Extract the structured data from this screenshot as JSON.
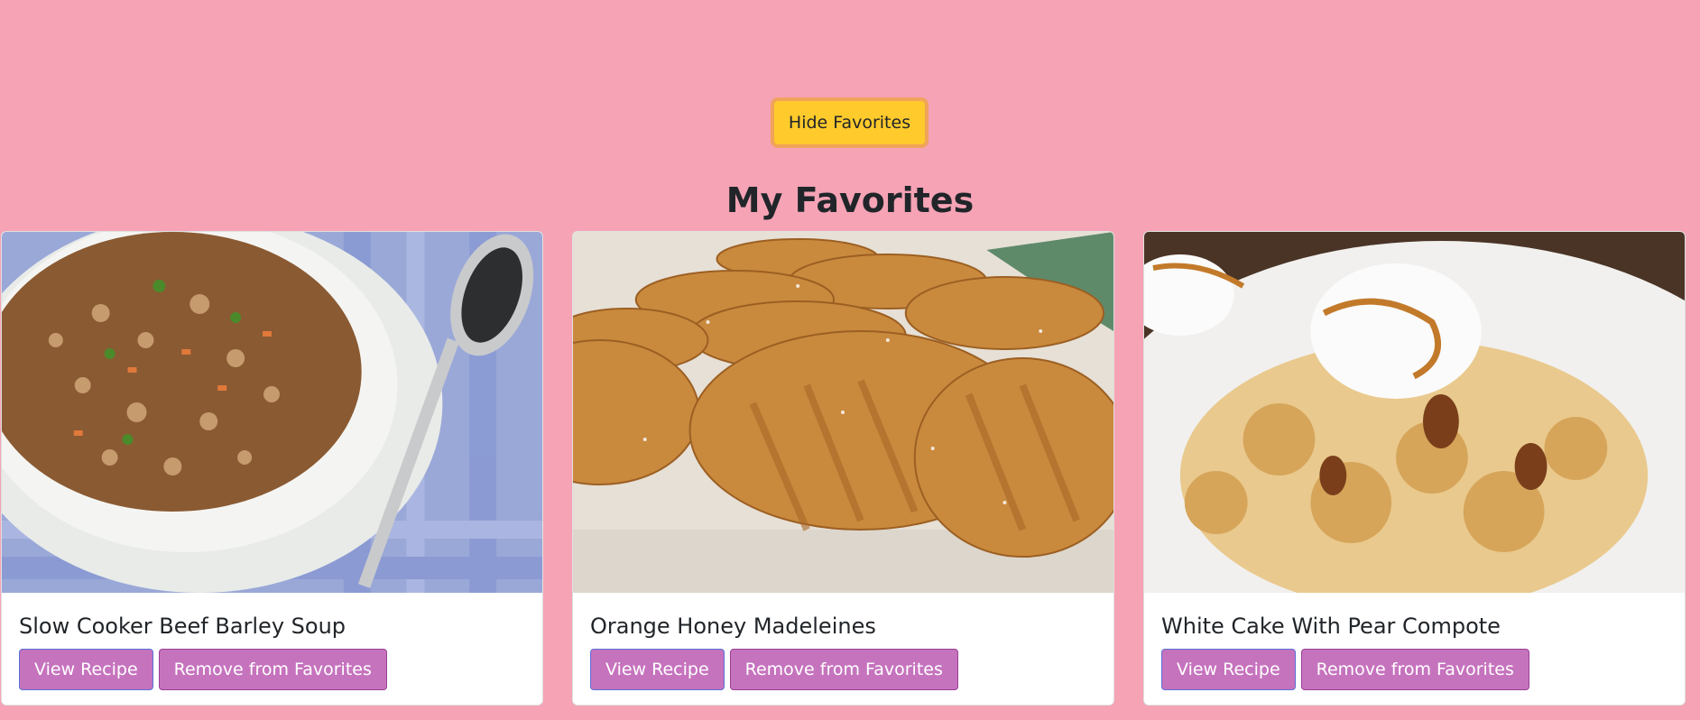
{
  "toolbar": {
    "toggle_label": "Hide Favorites",
    "toggle_color": "#ffca2c"
  },
  "heading": "My Favorites",
  "colors": {
    "page_background": "#f5a3b5",
    "button_background": "#c673be"
  },
  "favorites": [
    {
      "title": "Slow Cooker Beef Barley Soup",
      "image_icon": "soup-bowl-image",
      "view_label": "View Recipe",
      "remove_label": "Remove from Favorites"
    },
    {
      "title": "Orange Honey Madeleines",
      "image_icon": "madeleines-image",
      "view_label": "View Recipe",
      "remove_label": "Remove from Favorites"
    },
    {
      "title": "White Cake With Pear Compote",
      "image_icon": "pear-cake-image",
      "view_label": "View Recipe",
      "remove_label": "Remove from Favorites"
    }
  ]
}
